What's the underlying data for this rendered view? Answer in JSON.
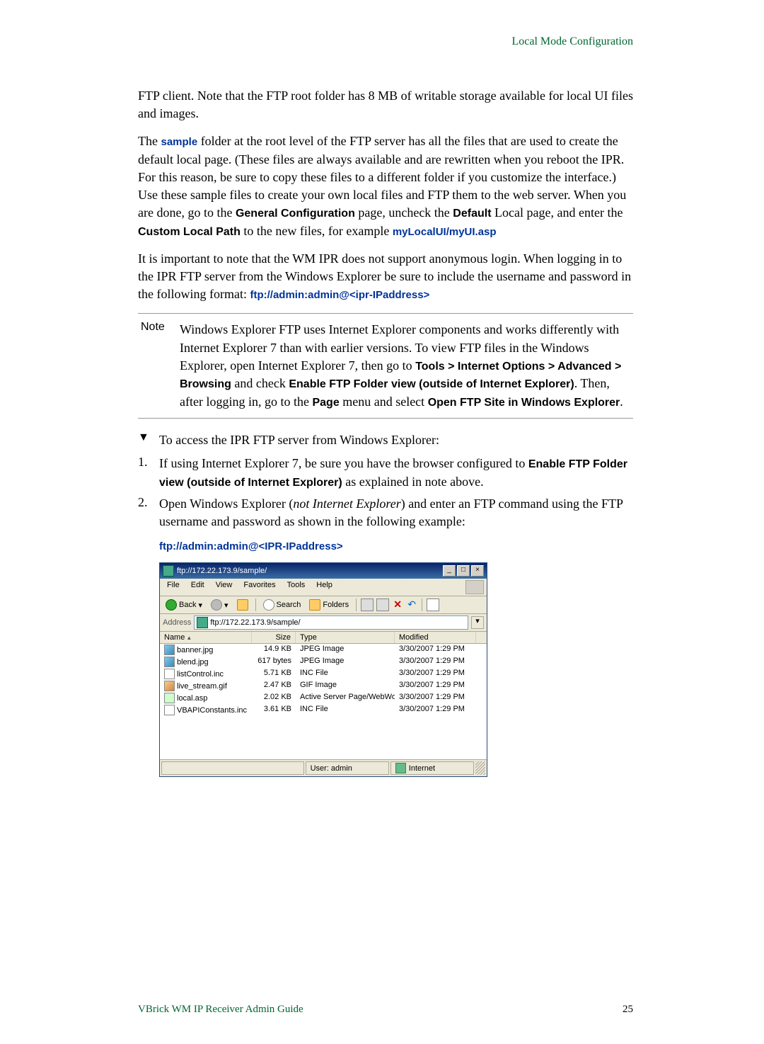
{
  "header": {
    "section": "Local Mode Configuration"
  },
  "p1": "FTP client. Note that the FTP root folder has 8 MB of writable storage available for local UI files and images.",
  "p2a": "The ",
  "p2b": "sample",
  "p2c": " folder at the root level of the FTP server has all the files that are used to create the default local page. (These files are always available and are rewritten when you reboot the IPR. For this reason, be sure to copy these files to a different folder if you customize the interface.) Use these sample files to create your own local files and FTP them to the web server. When you are done, go to the ",
  "p2d": "General Configuration",
  "p2e": " page, uncheck the ",
  "p2f": "Default",
  "p2g": " Local page, and enter the ",
  "p2h": "Custom Local Path",
  "p2i": " to the new files, for example ",
  "p2j": "myLocalUI/myUI.asp",
  "p3a": "It is important to note that the WM IPR does not support anonymous login. When logging in to the IPR FTP server from the Windows Explorer be sure to include the username and password in the following format: ",
  "p3b": "ftp://admin:admin@<ipr-IPaddress>",
  "note": {
    "label": "Note",
    "a": "Windows Explorer FTP uses Internet Explorer components and works differently with Internet Explorer 7 than with earlier versions. To view FTP files in the Windows Explorer, open Internet Explorer 7, then go to ",
    "b": "Tools > Internet Options > Advanced > Browsing",
    "c": " and check ",
    "d": "Enable FTP Folder view (outside of Internet Explorer)",
    "e": ". Then, after logging in, go to the ",
    "f": "Page",
    "g": " menu and select ",
    "h": "Open FTP Site in Windows Explorer",
    "i": "."
  },
  "proc": {
    "marker": "▼",
    "text": "To access the IPR FTP server from Windows Explorer:"
  },
  "steps": [
    {
      "n": "1.",
      "a": "If using Internet Explorer 7, be sure you have the browser configured to ",
      "b": "Enable FTP Folder view (outside of Internet Explorer)",
      "c": " as explained in note above."
    },
    {
      "n": "2.",
      "a": "Open Windows Explorer (",
      "b": "not Internet Explorer",
      "c": ") and enter an FTP command using the FTP username and password as shown in the following example:"
    }
  ],
  "ftp_example": "ftp://admin:admin@<IPR-IPaddress>",
  "explorer": {
    "title": "ftp://172.22.173.9/sample/",
    "menus": [
      "File",
      "Edit",
      "View",
      "Favorites",
      "Tools",
      "Help"
    ],
    "toolbar": {
      "back": "Back",
      "search": "Search",
      "folders": "Folders"
    },
    "address_label": "Address",
    "address_value": "ftp://172.22.173.9/sample/",
    "columns": {
      "name": "Name",
      "size": "Size",
      "type": "Type",
      "modified": "Modified"
    },
    "files": [
      {
        "icon": "fi-img",
        "name": "banner.jpg",
        "size": "14.9 KB",
        "type": "JPEG Image",
        "mod": "3/30/2007 1:29 PM"
      },
      {
        "icon": "fi-img",
        "name": "blend.jpg",
        "size": "617 bytes",
        "type": "JPEG Image",
        "mod": "3/30/2007 1:29 PM"
      },
      {
        "icon": "fi-inc",
        "name": "listControl.inc",
        "size": "5.71 KB",
        "type": "INC File",
        "mod": "3/30/2007 1:29 PM"
      },
      {
        "icon": "fi-gif",
        "name": "live_stream.gif",
        "size": "2.47 KB",
        "type": "GIF Image",
        "mod": "3/30/2007 1:29 PM"
      },
      {
        "icon": "fi-asp",
        "name": "local.asp",
        "size": "2.02 KB",
        "type": "Active Server Page/WebWo...",
        "mod": "3/30/2007 1:29 PM"
      },
      {
        "icon": "fi-inc",
        "name": "VBAPIConstants.inc",
        "size": "3.61 KB",
        "type": "INC File",
        "mod": "3/30/2007 1:29 PM"
      }
    ],
    "status": {
      "user": "User: admin",
      "zone": "Internet"
    }
  },
  "footer": {
    "left": "VBrick WM IP Receiver Admin Guide",
    "right": "25"
  }
}
